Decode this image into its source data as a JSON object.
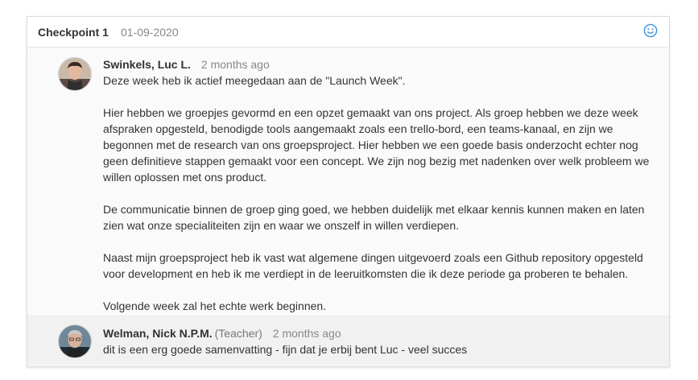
{
  "checkpoint": {
    "title": "Checkpoint 1",
    "date": "01-09-2020",
    "reaction_icon": "smiley-icon",
    "accent_color": "#3a8fd9"
  },
  "comments": [
    {
      "author": "Swinkels, Luc L.",
      "role": "",
      "time": "2 months ago",
      "avatar_icon": "user-avatar",
      "paragraphs": [
        "Deze week heb ik actief meegedaan aan de \"Launch Week\".",
        "Hier hebben we groepjes gevormd en een opzet gemaakt van ons project. Als groep hebben we deze week afspraken opgesteld, benodigde tools aangemaakt zoals een trello-bord, een teams-kanaal, en zijn we begonnen met de research van ons groepsproject. Hier hebben we een goede basis onderzocht echter nog geen definitieve stappen gemaakt voor een concept. We zijn nog bezig met nadenken over welk probleem we willen oplossen met ons product.",
        "De communicatie binnen de groep ging goed, we hebben duidelijk met elkaar kennis kunnen maken en laten zien wat onze specialiteiten zijn en waar we onszelf in willen verdiepen.",
        "Naast mijn groepsproject heb ik vast wat algemene dingen uitgevoerd zoals een Github repository opgesteld voor development en heb ik me verdiept in de leeruitkomsten die ik deze periode ga proberen te behalen.",
        "Volgende week zal het echte werk beginnen."
      ]
    },
    {
      "author": "Welman, Nick N.P.M.",
      "role": "(Teacher)",
      "time": "2 months ago",
      "avatar_icon": "user-avatar",
      "paragraphs": [
        "dit is een erg goede samenvatting - fijn dat je erbij bent Luc - veel succes"
      ]
    }
  ]
}
